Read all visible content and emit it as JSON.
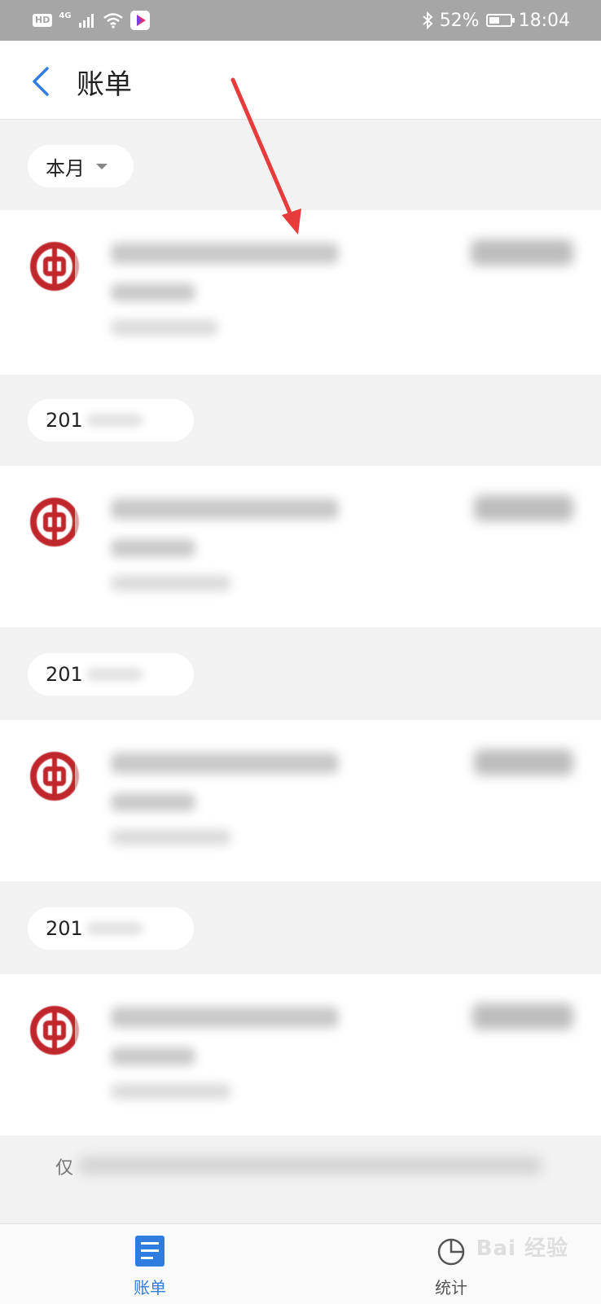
{
  "status_bar": {
    "hd": "HD",
    "network": "4G",
    "battery_text": "52%",
    "battery_level": 0.52,
    "time": "18:04",
    "icons": [
      "hd-icon",
      "signal-icon",
      "wifi-icon",
      "video-app-icon",
      "bluetooth-icon",
      "battery-icon"
    ]
  },
  "header": {
    "title": "账单",
    "back_icon": "chevron-left-icon"
  },
  "filter": {
    "month_label": "本月"
  },
  "sections": [
    {
      "label": "201"
    },
    {
      "label": "201"
    },
    {
      "label": "201"
    }
  ],
  "bottom_note": {
    "visible_text": "仅"
  },
  "tabs": [
    {
      "label": "账单",
      "icon": "bill-list-icon",
      "active": true
    },
    {
      "label": "统计",
      "icon": "pie-chart-icon",
      "active": false
    }
  ],
  "watermark": "Bai 经验",
  "colors": {
    "accent": "#2f7de1",
    "bank_red": "#c0272d",
    "arrow_red": "#e83b3b",
    "status_bar": "#a6a6a6"
  }
}
